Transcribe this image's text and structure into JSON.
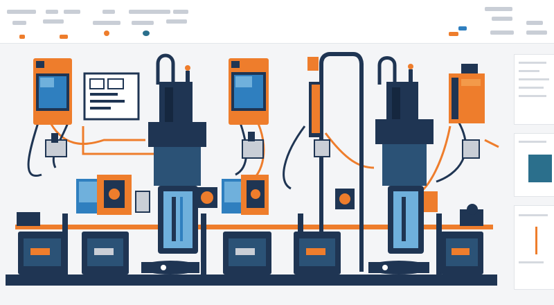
{
  "colors": {
    "navy": "#1f3553",
    "navy_dark": "#15273f",
    "orange": "#ee7d2c",
    "orange_light": "#f39a4a",
    "blue_screen": "#2f7fbf",
    "blue_light": "#6fb0dc",
    "gray_line": "#c9ced6",
    "panel_bg": "#ffffff",
    "teal": "#2b6f8c"
  },
  "icons": {
    "monitor_a": "monitor-icon",
    "monitor_b": "monitor-icon",
    "control_panel": "control-panel-icon",
    "press_a": "press-machine-icon",
    "press_b": "press-machine-icon",
    "base_units": "machine-base-icon"
  }
}
